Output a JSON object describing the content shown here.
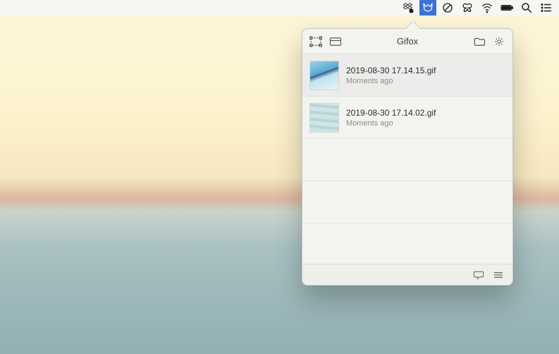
{
  "menubar": {
    "items": [
      {
        "name": "dropbox-icon"
      },
      {
        "name": "gifox-icon",
        "active": true
      },
      {
        "name": "circle-slash-icon"
      },
      {
        "name": "butterfly-icon"
      },
      {
        "name": "wifi-icon"
      },
      {
        "name": "battery-icon"
      },
      {
        "name": "search-icon"
      },
      {
        "name": "list-icon"
      }
    ]
  },
  "popover": {
    "title": "Gifox",
    "header_buttons": {
      "selection": "selection-capture-icon",
      "window": "window-capture-icon",
      "folder": "folder-icon",
      "settings": "gear-icon"
    },
    "rows": [
      {
        "title": "2019-08-30 17.14.15.gif",
        "subtitle": "Moments ago",
        "thumb": "surf",
        "selected": true
      },
      {
        "title": "2019-08-30 17.14.02.gif",
        "subtitle": "Moments ago",
        "thumb": "waves",
        "selected": false
      }
    ],
    "footer": {
      "feedback": "speech-bubble-icon",
      "menu": "hamburger-icon"
    }
  }
}
